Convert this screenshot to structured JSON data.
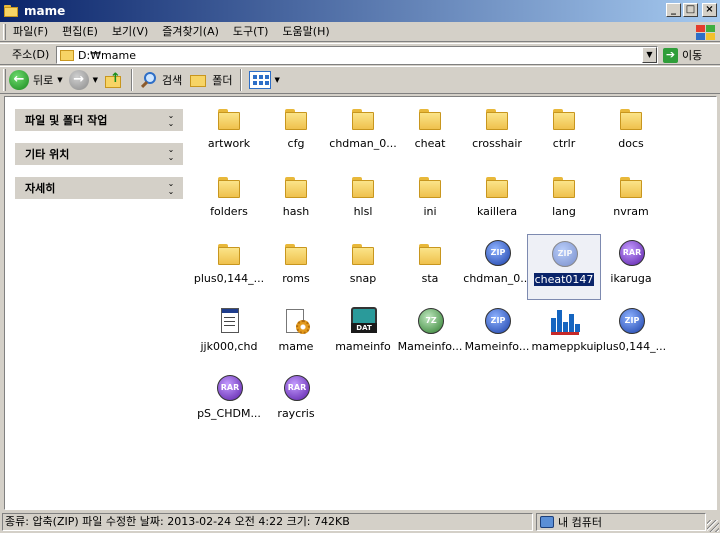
{
  "window": {
    "title": "mame"
  },
  "menu": [
    "파일(F)",
    "편집(E)",
    "보기(V)",
    "즐겨찾기(A)",
    "도구(T)",
    "도움말(H)"
  ],
  "address": {
    "label": "주소(D)",
    "value": "D:₩mame",
    "go_label": "이동"
  },
  "toolbar": {
    "back_label": "뒤로",
    "search_label": "검색",
    "folders_label": "폴더"
  },
  "taskpane": {
    "panels": [
      {
        "title": "파일 및 폴더 작업"
      },
      {
        "title": "기타 위치"
      },
      {
        "title": "자세히"
      }
    ]
  },
  "items": [
    {
      "name": "artwork",
      "type": "folder"
    },
    {
      "name": "cfg",
      "type": "folder"
    },
    {
      "name": "chdman_0...",
      "type": "folder"
    },
    {
      "name": "cheat",
      "type": "folder"
    },
    {
      "name": "crosshair",
      "type": "folder"
    },
    {
      "name": "ctrlr",
      "type": "folder"
    },
    {
      "name": "docs",
      "type": "folder"
    },
    {
      "name": "folders",
      "type": "folder"
    },
    {
      "name": "hash",
      "type": "folder"
    },
    {
      "name": "hlsl",
      "type": "folder"
    },
    {
      "name": "ini",
      "type": "folder"
    },
    {
      "name": "kaillera",
      "type": "folder"
    },
    {
      "name": "lang",
      "type": "folder"
    },
    {
      "name": "nvram",
      "type": "folder"
    },
    {
      "name": "plus0,144_...",
      "type": "folder"
    },
    {
      "name": "roms",
      "type": "folder"
    },
    {
      "name": "snap",
      "type": "folder"
    },
    {
      "name": "sta",
      "type": "folder"
    },
    {
      "name": "chdman_0...",
      "type": "zip",
      "badge": "ZIP"
    },
    {
      "name": "cheat0147",
      "type": "zip",
      "badge": "ZIP",
      "selected": true
    },
    {
      "name": "ikaruga",
      "type": "rar",
      "badge": "RAR"
    },
    {
      "name": "jjk000,chd",
      "type": "doc"
    },
    {
      "name": "mame",
      "type": "exe"
    },
    {
      "name": "mameinfo",
      "type": "dat",
      "badge": "DAT"
    },
    {
      "name": "Mameinfo...",
      "type": "sz",
      "badge": "7Z"
    },
    {
      "name": "Mameinfo...",
      "type": "zip",
      "badge": "ZIP"
    },
    {
      "name": "mameppkui",
      "type": "mameui"
    },
    {
      "name": "plus0,144_...",
      "type": "zip",
      "badge": "ZIP"
    },
    {
      "name": "pS_CHDM...",
      "type": "rar",
      "badge": "RAR"
    },
    {
      "name": "raycris",
      "type": "rar",
      "badge": "RAR"
    }
  ],
  "status": {
    "left": "종류: 압축(ZIP) 파일 수정한 날짜: 2013-02-24 오전 4:22 크기: 742KB",
    "right": "내 컴퓨터"
  }
}
